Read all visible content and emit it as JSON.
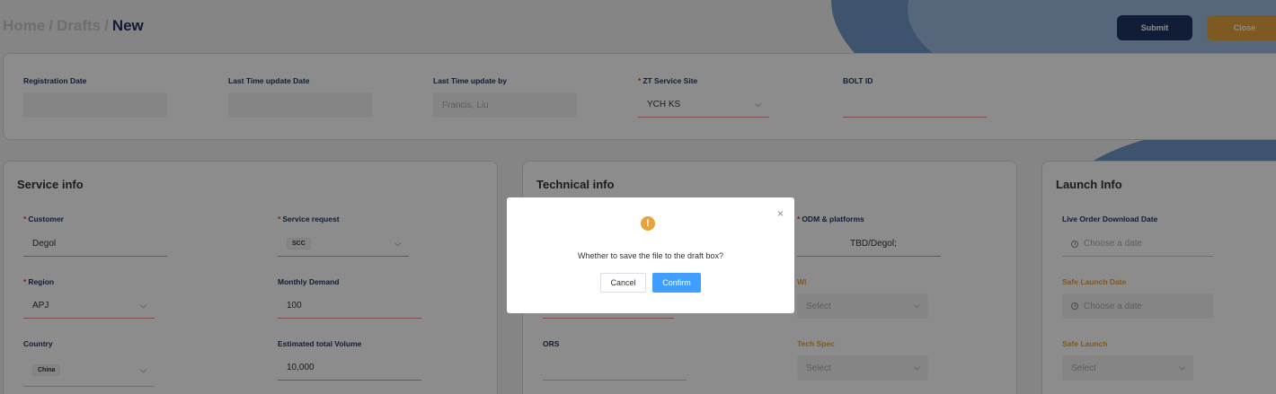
{
  "breadcrumb": {
    "home": "Home",
    "drafts": "Drafts",
    "current": "New"
  },
  "actions": {
    "submit": "Submit",
    "close": "Close"
  },
  "registration": {
    "registration_date_label": "Registration Date",
    "last_update_date_label": "Last Time update Date",
    "last_update_by_label": "Last Time update by",
    "last_update_by_value": "Francis, Liu",
    "service_site_label": "ZT Service Site",
    "service_site_value": "YCH KS",
    "bolt_id_label": "BOLT ID"
  },
  "service_info": {
    "title": "Service info",
    "customer_label": "Customer",
    "customer_value": "Degol",
    "service_request_label": "Service request",
    "service_request_tag": "SCC",
    "region_label": "Region",
    "region_value": "APJ",
    "monthly_demand_label": "Monthly Demand",
    "monthly_demand_value": "100",
    "country_label": "Country",
    "country_tag": "China",
    "total_volume_label": "Estimated total Volume",
    "total_volume_value": "10,000"
  },
  "technical_info": {
    "title": "Technical info",
    "odm_label": "ODM & platforms",
    "odm_value": "TBD/Degol;",
    "wi_label": "WI",
    "wi_placeholder": "Select",
    "ors_label": "ORS",
    "tech_spec_label": "Tech Spec",
    "tech_spec_placeholder": "Select"
  },
  "launch_info": {
    "title": "Launch Info",
    "live_order_label": "Live Order Download Date",
    "live_order_placeholder": "Choose a date",
    "safe_launch_date_label": "Safe Launch Date",
    "safe_launch_date_placeholder": "Choose a date",
    "safe_launch_label": "Safe Launch",
    "safe_launch_placeholder": "Select"
  },
  "dialog": {
    "message": "Whether to save the file to the draft box?",
    "cancel": "Cancel",
    "confirm": "Confirm",
    "close_glyph": "×",
    "warning_glyph": "!"
  },
  "colors": {
    "primary": "#1f3564",
    "accent": "#e6a23c",
    "confirm": "#409eff",
    "required": "#e23c3c"
  }
}
